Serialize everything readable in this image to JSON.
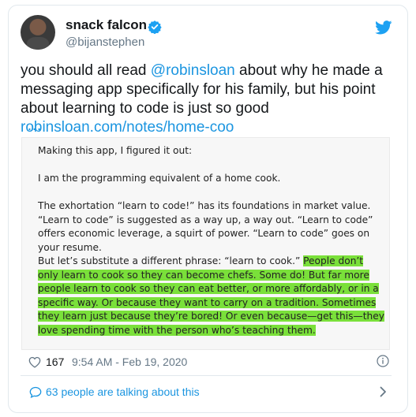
{
  "author": {
    "name": "snack falcon",
    "handle": "@bijanstephen"
  },
  "icons": {
    "verified": "verified-badge-icon",
    "brand": "twitter-bird-icon",
    "like": "heart-icon",
    "info": "info-icon",
    "reply": "speech-bubble-icon",
    "chevron": "chevron-right-icon"
  },
  "colors": {
    "link": "#1b95e0",
    "highlight": "#7ae03a",
    "text": "#14171a",
    "muted": "#657786"
  },
  "tweet": {
    "text_1": "you should all read ",
    "mention": "@robinsloan",
    "text_2": " about why he made a messaging app specifically for his family, but his point about learning to code is just so good ",
    "link": "robinsloan.com/notes/home-coo",
    "ellipsis": "…"
  },
  "attached_image": {
    "p1": "Making this app, I figured it out:",
    "p2": "I am the programming equivalent of a home cook.",
    "p3": "The exhortation “learn to code!” has its foundations in market value. “Learn to code” is suggested as a way up, a way out. “Learn to code” offers economic leverage, a squirt of power. “Learn to code” goes on your resume.",
    "p4_plain": "But let’s substitute a different phrase: “learn to cook.” ",
    "p4_highlight": "People don’t only learn to cook so they can become chefs. Some do! But far more people learn to cook so they can eat better, or more affordably, or in a specific way. Or because they want to carry on a tradition. Sometimes they learn just because they’re bored! Or even because—get this—they love spending time with the person who’s teaching them."
  },
  "footer": {
    "likes": "167",
    "timestamp": "9:54 AM - Feb 19, 2020",
    "talking": "63 people are talking about this"
  }
}
